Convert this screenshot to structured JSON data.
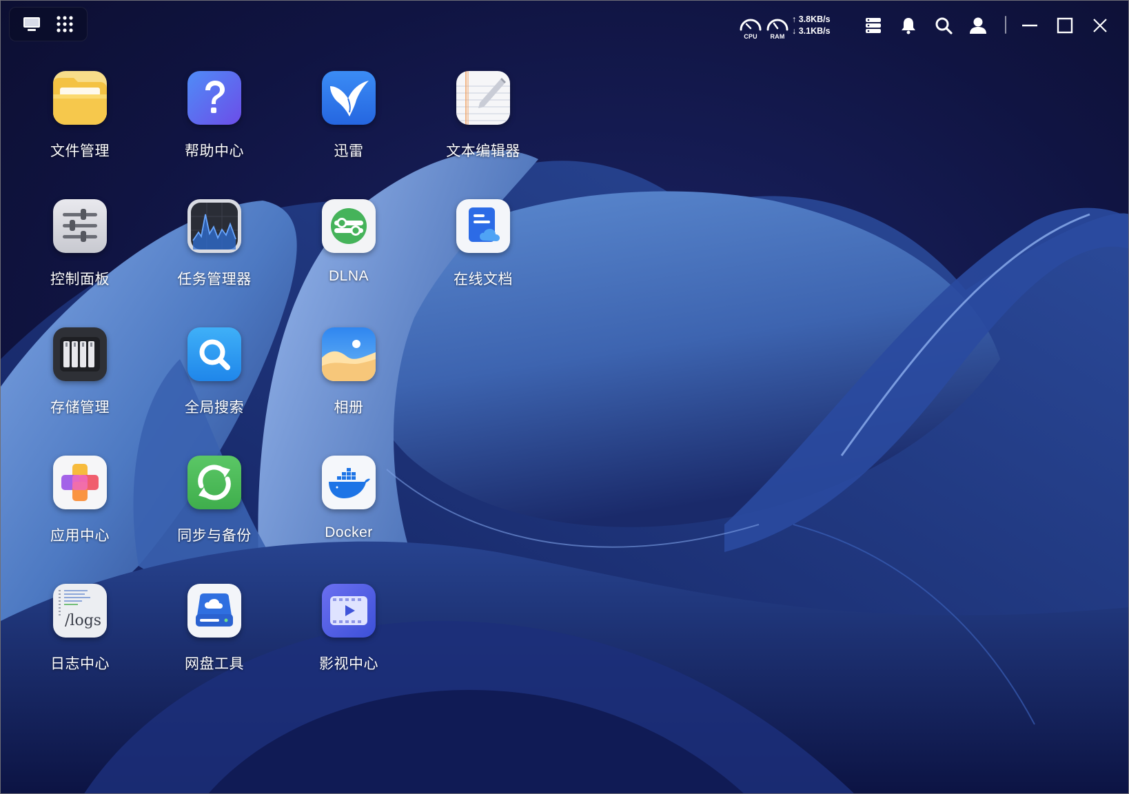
{
  "topbar": {
    "launcher": {
      "desktop_icon": "monitor-icon",
      "apps_icon": "grid-dots-icon"
    },
    "monitor": {
      "cpu_label": "CPU",
      "ram_label": "RAM",
      "upload": "3.8KB/s",
      "download": "3.1KB/s"
    },
    "icons": {
      "tasks": "stack-icon",
      "notifications": "bell-icon",
      "search": "search-icon",
      "user": "user-icon",
      "minimize": "minimize-icon",
      "maximize": "maximize-icon",
      "close": "close-icon"
    }
  },
  "desktop": {
    "apps": [
      {
        "label": "文件管理",
        "icon": "folder-icon"
      },
      {
        "label": "帮助中心",
        "icon": "help-icon"
      },
      {
        "label": "迅雷",
        "icon": "bird-icon"
      },
      {
        "label": "文本编辑器",
        "icon": "notepad-icon"
      },
      {
        "label": "控制面板",
        "icon": "sliders-icon"
      },
      {
        "label": "任务管理器",
        "icon": "activity-chart-icon"
      },
      {
        "label": "DLNA",
        "icon": "dlna-icon"
      },
      {
        "label": "在线文档",
        "icon": "cloud-doc-icon"
      },
      {
        "label": "存储管理",
        "icon": "drive-bays-icon"
      },
      {
        "label": "全局搜索",
        "icon": "magnifier-icon"
      },
      {
        "label": "相册",
        "icon": "photo-landscape-icon"
      },
      {
        "label": "应用中心",
        "icon": "app-store-icon"
      },
      {
        "label": "同步与备份",
        "icon": "sync-icon"
      },
      {
        "label": "Docker",
        "icon": "docker-whale-icon"
      },
      {
        "label": "日志中心",
        "icon": "logs-icon",
        "icon_text": "/logs"
      },
      {
        "label": "网盘工具",
        "icon": "cloud-drive-icon"
      },
      {
        "label": "影视中心",
        "icon": "video-player-icon"
      }
    ]
  },
  "colors": {
    "wallpaper_dark": "#0d1038",
    "wallpaper_blue": "#4f7fc8",
    "icon_folder": "#f6c64c",
    "icon_help": "#5b6cf0",
    "icon_thunder": "#2f7df2",
    "icon_dlna": "#45b85c",
    "icon_sync": "#4cbd58",
    "icon_video": "#5865e8"
  }
}
